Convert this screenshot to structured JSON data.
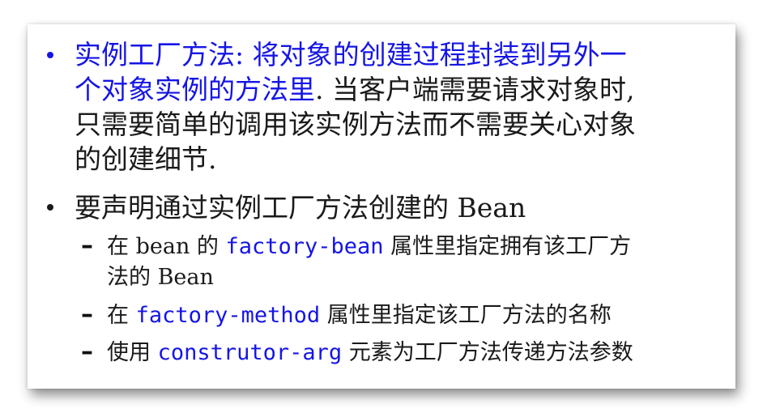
{
  "bullet1": {
    "highlight": "实例工厂方法: 将对象的创建过程封装到另外一个对象实例的方法里",
    "line1_blue": "实例工厂方法: 将对象的创建过程封装到另外一",
    "line2_blue": "个对象实例的方法里",
    "line2_rest": ". 当客户端需要请求对象时,",
    "line3": "只需要简单的调用该实例方法而不需要关心对象",
    "line4": "的创建细节."
  },
  "bullet2": {
    "text": "要声明通过实例工厂方法创建的 Bean"
  },
  "subitems": [
    {
      "pre": "在 bean 的 ",
      "code": "factory-bean",
      "post": " 属性里指定拥有该工厂方",
      "cont": "法的 Bean"
    },
    {
      "pre": "在 ",
      "code": "factory-method",
      "post": " 属性里指定该工厂方法的名称"
    },
    {
      "pre": "使用 ",
      "code": "construtor-arg",
      "post": " 元素为工厂方法传递方法参数"
    }
  ],
  "colors": {
    "accent": "#1515e6",
    "text": "#1a1a1a"
  }
}
